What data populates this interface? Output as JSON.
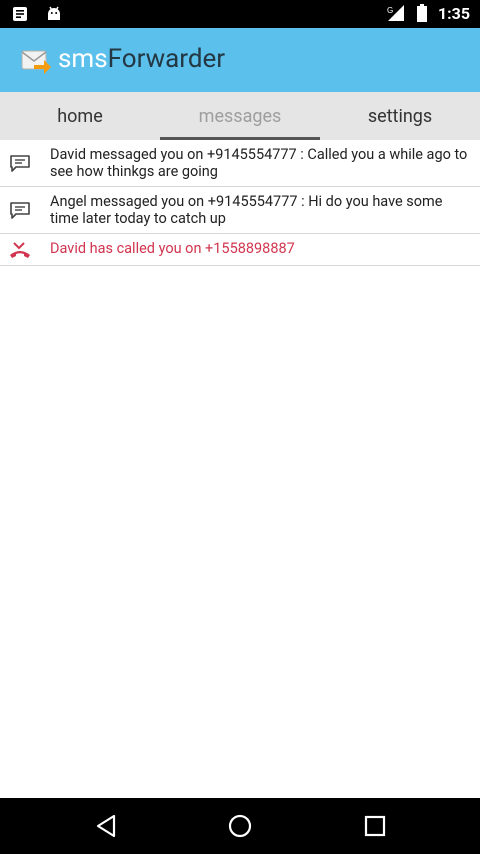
{
  "status_bar": {
    "time": "1:35",
    "left_icons": [
      "notes-icon",
      "android-icon"
    ],
    "right_icons": [
      "signal-icon",
      "battery-icon"
    ]
  },
  "app_bar": {
    "title_part1": "sms",
    "title_part2": "Forwarder",
    "logo_icon": "mail-forward-icon",
    "color": "#5bc0eb"
  },
  "tabs": [
    {
      "label": "home",
      "active": false
    },
    {
      "label": "messages",
      "active": true
    },
    {
      "label": "settings",
      "active": false
    }
  ],
  "messages": [
    {
      "type": "sms",
      "icon": "chat-icon",
      "text": "David messaged you on +9145554777 : Called you a while ago to see how thinkgs are going"
    },
    {
      "type": "sms",
      "icon": "chat-icon",
      "text": "Angel messaged you on +9145554777 : Hi do you have some time later today to catch up"
    },
    {
      "type": "call",
      "icon": "missed-call-icon",
      "text": "David has called you on +1558898887",
      "color": "#d1354f"
    }
  ],
  "nav_bar": {
    "buttons": [
      "back-icon",
      "home-icon",
      "recents-icon"
    ]
  }
}
